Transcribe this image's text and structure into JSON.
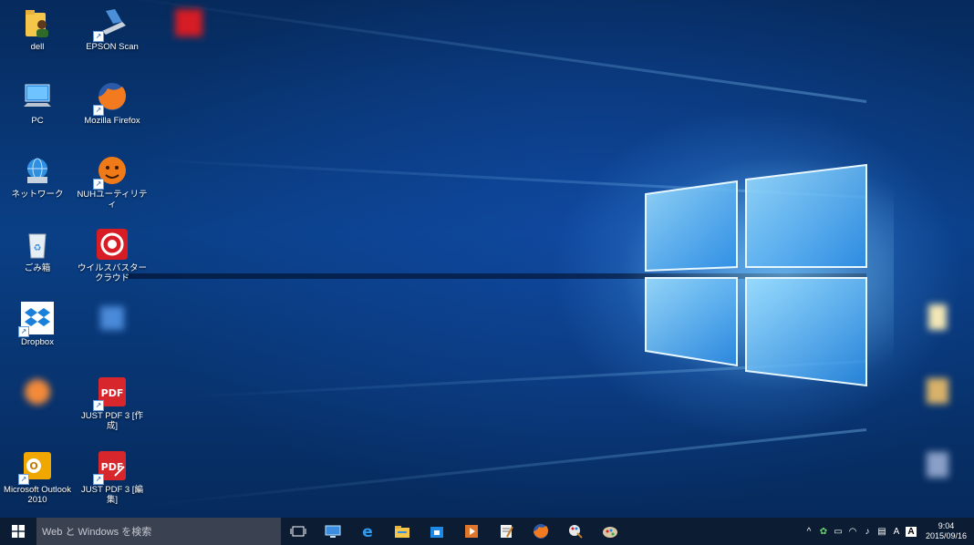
{
  "desktop_icons": [
    {
      "label": "dell",
      "icon": "user-folder-icon"
    },
    {
      "label": "EPSON Scan",
      "icon": "scanner-icon"
    },
    {
      "label": "",
      "icon": "blurred-app-icon"
    },
    {
      "label": "PC",
      "icon": "computer-icon"
    },
    {
      "label": "Mozilla Firefox",
      "icon": "firefox-icon"
    },
    {
      "label": "ネットワーク",
      "icon": "network-icon"
    },
    {
      "label": "NUHユーティリティ",
      "icon": "nuh-utility-icon"
    },
    {
      "label": "ごみ箱",
      "icon": "recycle-bin-icon"
    },
    {
      "label": "ウイルスバスター クラウド",
      "icon": "virusbuster-icon"
    },
    {
      "label": "Dropbox",
      "icon": "dropbox-icon"
    },
    {
      "label": "JUST PDF 3 [作成]",
      "icon": "pdf-create-icon"
    },
    {
      "label": "Microsoft Outlook 2010",
      "icon": "outlook-icon"
    },
    {
      "label": "JUST PDF 3 [編集]",
      "icon": "pdf-edit-icon"
    }
  ],
  "taskbar": {
    "search_placeholder": "Web と Windows を検索",
    "pinned": [
      "task-view-icon",
      "remote-desktop-icon",
      "edge-icon",
      "file-explorer-icon",
      "store-icon",
      "media-player-icon",
      "notepad-icon",
      "firefox-icon",
      "paint-tool-icon",
      "paint-palette-icon"
    ],
    "tray": {
      "ime_mode": "A",
      "time": "9:04",
      "date": "2015/09/16"
    }
  },
  "colors": {
    "accent": "#0a78d7",
    "taskbar": "#0b1c33",
    "search_box": "#3a4150"
  }
}
